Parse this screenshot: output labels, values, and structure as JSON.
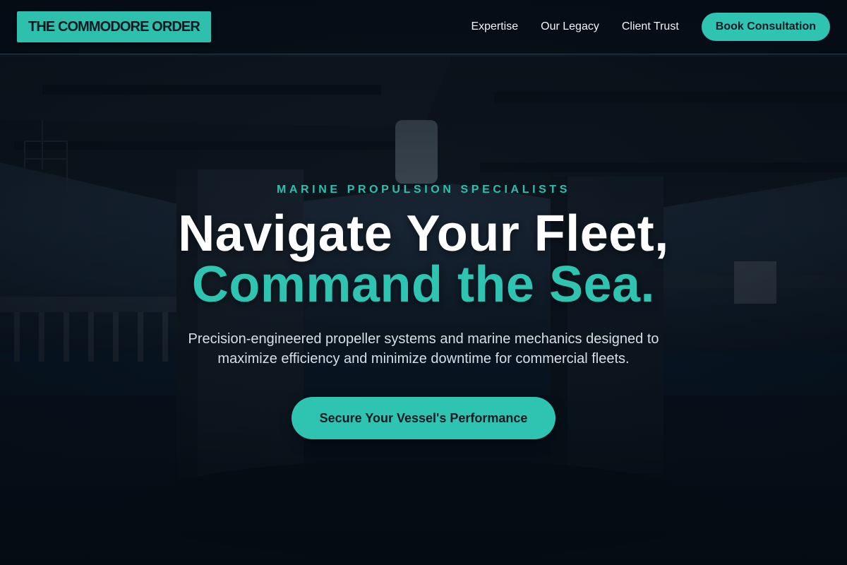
{
  "brand": {
    "logo_text": "THE COMMODORE ORDER"
  },
  "nav": {
    "links": [
      "Expertise",
      "Our Legacy",
      "Client Trust"
    ],
    "cta_label": "Book Consultation"
  },
  "hero": {
    "eyebrow": "MARINE PROPULSION SPECIALISTS",
    "headline_line1": "Navigate Your Fleet,",
    "headline_line2": "Command the Sea.",
    "subtext_line1": "Precision-engineered propeller systems and marine mechanics designed to",
    "subtext_line2": "maximize efficiency and minimize downtime for commercial fleets.",
    "cta_label": "Secure Your Vessel's Performance",
    "background_image": "bridge-underside-over-water"
  },
  "colors": {
    "accent": "#2fc4b2",
    "header_bg": "#040a12",
    "page_bg": "#050c14",
    "text_primary": "#ffffff",
    "text_secondary": "#d8dfe6"
  }
}
